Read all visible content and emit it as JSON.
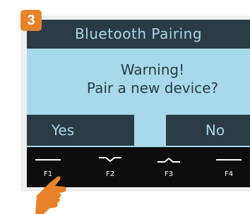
{
  "step_badge": "3",
  "screen": {
    "title": "Bluetooth Pairing",
    "message_line1": "Warning!",
    "message_line2": "Pair a new device?",
    "softkeys": {
      "left": "Yes",
      "right": "No"
    }
  },
  "function_keys": [
    {
      "label": "F1",
      "icon": "line-icon"
    },
    {
      "label": "F2",
      "icon": "chevron-down-icon"
    },
    {
      "label": "F3",
      "icon": "chevron-up-icon"
    },
    {
      "label": "F4",
      "icon": "line-icon"
    }
  ],
  "pointer": {
    "icon": "pointing-hand-icon",
    "target": "F1"
  },
  "colors": {
    "accent": "#e8822a",
    "screen_bg": "#a7d9ea",
    "bar_bg": "#2b3b45",
    "key_bar_bg": "#0d0d0d"
  }
}
